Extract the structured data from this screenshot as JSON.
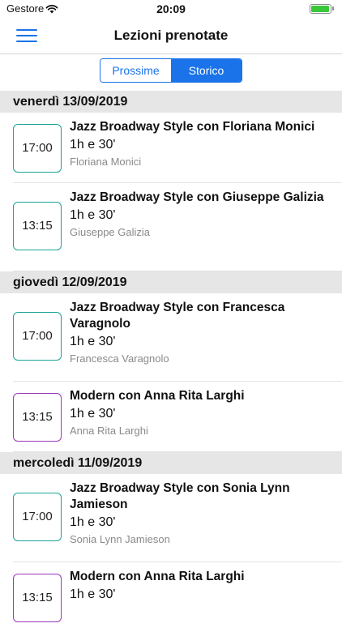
{
  "status": {
    "carrier": "Gestore",
    "time": "20:09"
  },
  "nav": {
    "title": "Lezioni prenotate"
  },
  "tabs": [
    {
      "label": "Prossime"
    },
    {
      "label": "Storico"
    }
  ],
  "days": [
    {
      "header": "venerdì 13/09/2019",
      "lessons": [
        {
          "time": "17:00",
          "title": "Jazz Broadway Style con Floriana Monici",
          "duration": "1h e 30'",
          "teacher": "Floriana Monici",
          "color": "#1aa39a"
        },
        {
          "time": "13:15",
          "title": "Jazz Broadway Style con Giuseppe Galizia",
          "duration": "1h e 30'",
          "teacher": "Giuseppe Galizia",
          "color": "#1aa39a"
        }
      ]
    },
    {
      "header": "giovedì 12/09/2019",
      "lessons": [
        {
          "time": "17:00",
          "title": "Jazz Broadway Style con Francesca Varagnolo",
          "duration": "1h e 30'",
          "teacher": "Francesca Varagnolo",
          "color": "#1aa39a"
        },
        {
          "time": "13:15",
          "title": "Modern con Anna Rita Larghi",
          "duration": "1h e 30'",
          "teacher": "Anna Rita  Larghi",
          "color": "#9b37b8"
        }
      ]
    },
    {
      "header": "mercoledì 11/09/2019",
      "lessons": [
        {
          "time": "17:00",
          "title": "Jazz Broadway Style con Sonia Lynn Jamieson",
          "duration": "1h e 30'",
          "teacher": "Sonia Lynn Jamieson",
          "color": "#1aa39a"
        },
        {
          "time": "13:15",
          "title": "Modern con Anna Rita Larghi",
          "duration": "1h e 30'",
          "teacher": "",
          "color": "#9b37b8"
        }
      ]
    }
  ]
}
